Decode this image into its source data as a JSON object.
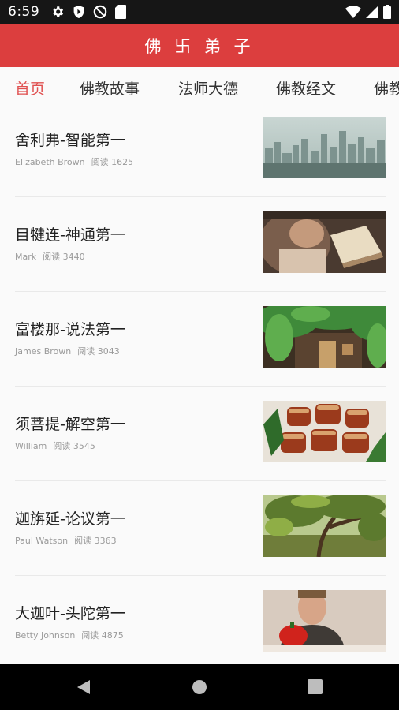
{
  "status_bar": {
    "time": "6:59",
    "icons": [
      "gear-icon",
      "shield-icon",
      "no-entry-icon",
      "sd-card-icon"
    ],
    "right_icons": [
      "wifi-icon",
      "signal-icon",
      "battery-icon"
    ]
  },
  "app_bar": {
    "title": "佛 卐 弟 子"
  },
  "tabs": [
    {
      "label": "首页",
      "active": true
    },
    {
      "label": "佛教故事",
      "active": false
    },
    {
      "label": "法师大德",
      "active": false
    },
    {
      "label": "佛教经文",
      "active": false
    },
    {
      "label": "佛教",
      "active": false
    }
  ],
  "articles": [
    {
      "title": "舍利弗-智能第一",
      "author": "Elizabeth Brown",
      "reads": "阅读 1625",
      "image": "city-skyline"
    },
    {
      "title": "目犍连-神通第一",
      "author": "Mark",
      "reads": "阅读 3440",
      "image": "person-reading-book"
    },
    {
      "title": "富楼那-说法第一",
      "author": "James Brown",
      "reads": "阅读 3043",
      "image": "ivy-covered-building"
    },
    {
      "title": "须菩提-解空第一",
      "author": "William",
      "reads": "阅读 3545",
      "image": "braised-pork-dish"
    },
    {
      "title": "迦旃延-论议第一",
      "author": "Paul Watson",
      "reads": "阅读 3363",
      "image": "tree-in-garden"
    },
    {
      "title": "大迦叶-头陀第一",
      "author": "Betty Johnson",
      "reads": "阅读 4875",
      "image": "man-with-pepper"
    }
  ],
  "colors": {
    "accent": "#dc3e3e",
    "active_tab": "#e05050",
    "status_bar": "#161616"
  },
  "nav_bar": {
    "icons": [
      "back-icon",
      "home-icon",
      "recents-icon"
    ]
  }
}
